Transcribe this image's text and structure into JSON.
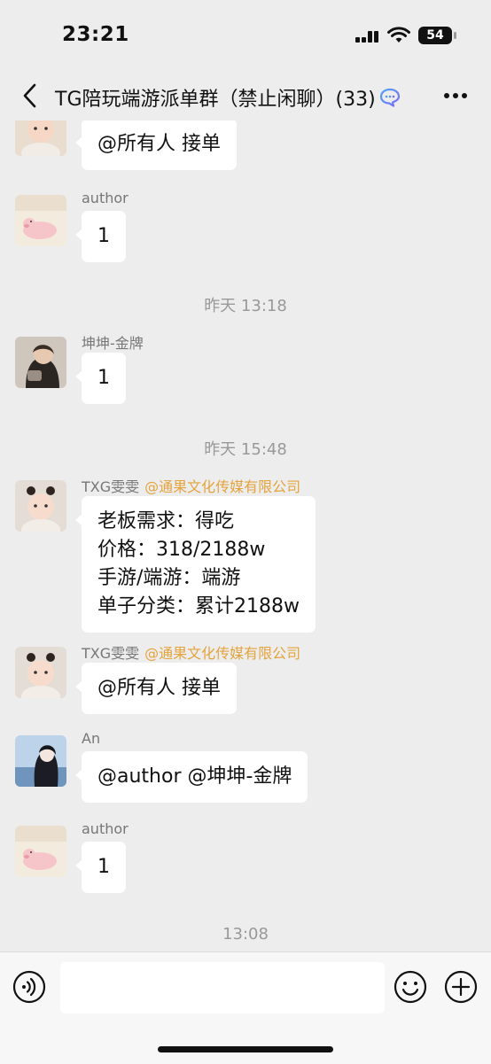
{
  "status_bar": {
    "time": "23:21",
    "battery": "54"
  },
  "nav": {
    "title": "TG陪玩端游派单群（禁止闲聊）(33)"
  },
  "messages": [
    {
      "sender": "",
      "company": "",
      "lines": [
        "@所有人 接单"
      ]
    },
    {
      "sender": "author",
      "company": "",
      "lines": [
        "1"
      ]
    },
    {
      "sender": "坤坤-金牌",
      "company": "",
      "lines": [
        "1"
      ]
    },
    {
      "sender": "TXG雯雯",
      "company": "@通果文化传媒有限公司",
      "lines": [
        "老板需求：得吃",
        "价格：318/2188w",
        "手游/端游：端游",
        "单子分类：累计2188w"
      ]
    },
    {
      "sender": "TXG雯雯",
      "company": "@通果文化传媒有限公司",
      "lines": [
        "@所有人 接单"
      ]
    },
    {
      "sender": "An",
      "company": "",
      "lines": [
        "@author @坤坤-金牌"
      ]
    },
    {
      "sender": "author",
      "company": "",
      "lines": [
        "1"
      ]
    }
  ],
  "timestamps": [
    "昨天 13:18",
    "昨天 15:48",
    "13:08"
  ],
  "colors": {
    "background": "#ededed",
    "bubble": "#ffffff",
    "company_tag": "#e4a33d",
    "meta_text": "#999999"
  },
  "icons": [
    "back-arrow-icon",
    "chat-bubble-icon",
    "more-icon",
    "voice-icon",
    "emoji-icon",
    "plus-icon"
  ]
}
